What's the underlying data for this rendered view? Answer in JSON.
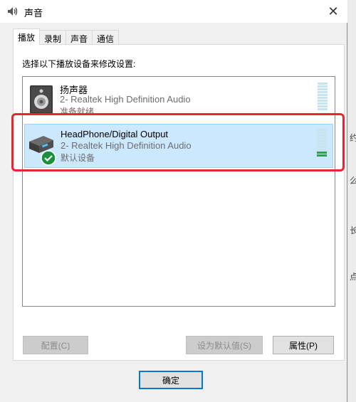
{
  "window": {
    "title": "声音",
    "close_glyph": "✕"
  },
  "tabs": [
    {
      "label": "播放",
      "active": true
    },
    {
      "label": "录制",
      "active": false
    },
    {
      "label": "声音",
      "active": false
    },
    {
      "label": "通信",
      "active": false
    }
  ],
  "panel": {
    "instruction": "选择以下播放设备来修改设置:",
    "devices": [
      {
        "name": "扬声器",
        "sub": "2- Realtek High Definition Audio",
        "status": "准备就绪",
        "selected": false,
        "level": 0
      },
      {
        "name": "HeadPhone/Digital Output",
        "sub": "2- Realtek High Definition Audio",
        "status": "默认设备",
        "selected": true,
        "level": 0.17
      }
    ]
  },
  "buttons": {
    "configure": "配置(C)",
    "set_default": "设为默认值(S)",
    "properties": "属性(P)",
    "ok": "确定"
  },
  "background_window": {
    "chars": [
      "约",
      "么",
      "长",
      "点"
    ]
  },
  "colors": {
    "selected_bg": "#cce8ff",
    "highlight_border": "#e8262f",
    "default_check": "#1a8f3c",
    "meter_active": "#2aa24a"
  }
}
